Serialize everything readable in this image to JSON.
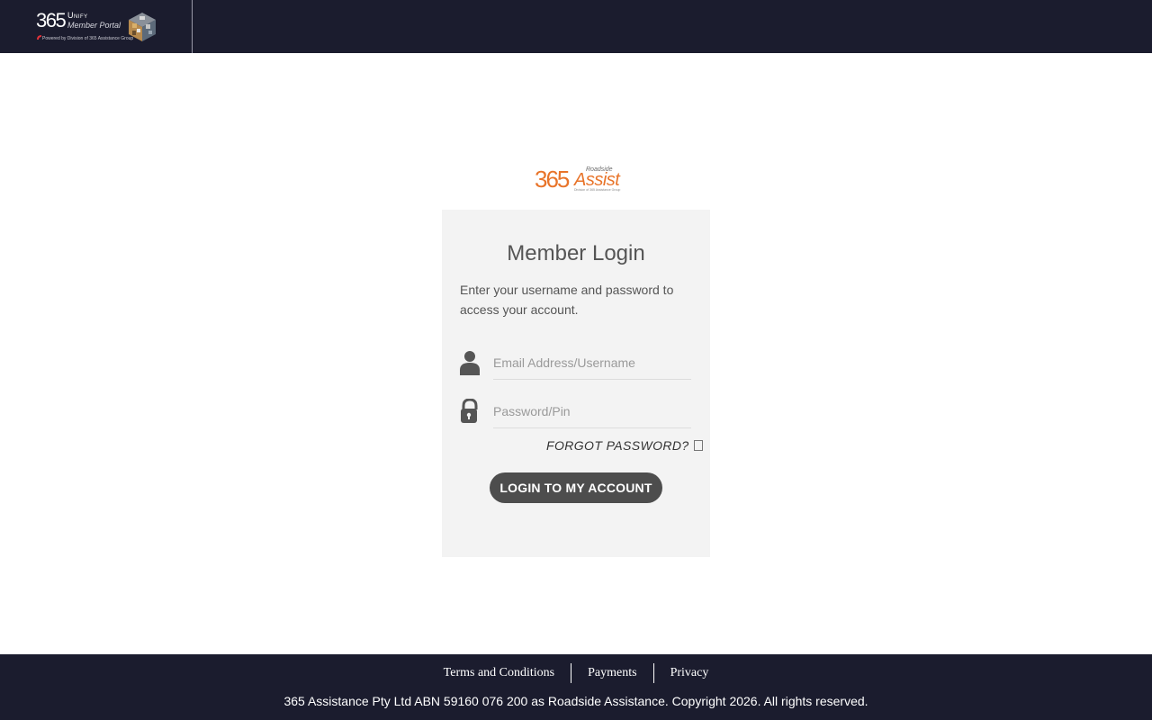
{
  "header": {
    "brand_number": "365",
    "brand_unify": "Unify",
    "brand_portal": "Member Portal",
    "brand_powered": "Powered by Division of 365 Assistance Group"
  },
  "center_logo": {
    "number": "365",
    "roadside": "Roadside",
    "assist": "Assist",
    "sub": "Division of 365 Assistance Group"
  },
  "login": {
    "title": "Member Login",
    "description": "Enter your username and password to access your account.",
    "username_placeholder": "Email Address/Username",
    "username_value": "",
    "password_placeholder": "Password/Pin",
    "password_value": "",
    "forgot_label": "FORGOT PASSWORD?",
    "submit_label": "LOGIN TO MY ACCOUNT"
  },
  "footer": {
    "links": [
      {
        "label": "Terms and Conditions"
      },
      {
        "label": "Payments"
      },
      {
        "label": "Privacy"
      }
    ],
    "copyright": "365 Assistance Pty Ltd ABN 59160 076 200 as Roadside Assistance. Copyright 2026. All rights reserved."
  },
  "colors": {
    "header_bg": "#1b1c2e",
    "brand_orange": "#e8742a",
    "card_bg": "#f3f3f3",
    "button_bg": "#4d4d4d"
  },
  "icons": {
    "user": "user-icon",
    "lock": "lock-icon",
    "forgot_box": "checkbox-icon"
  }
}
